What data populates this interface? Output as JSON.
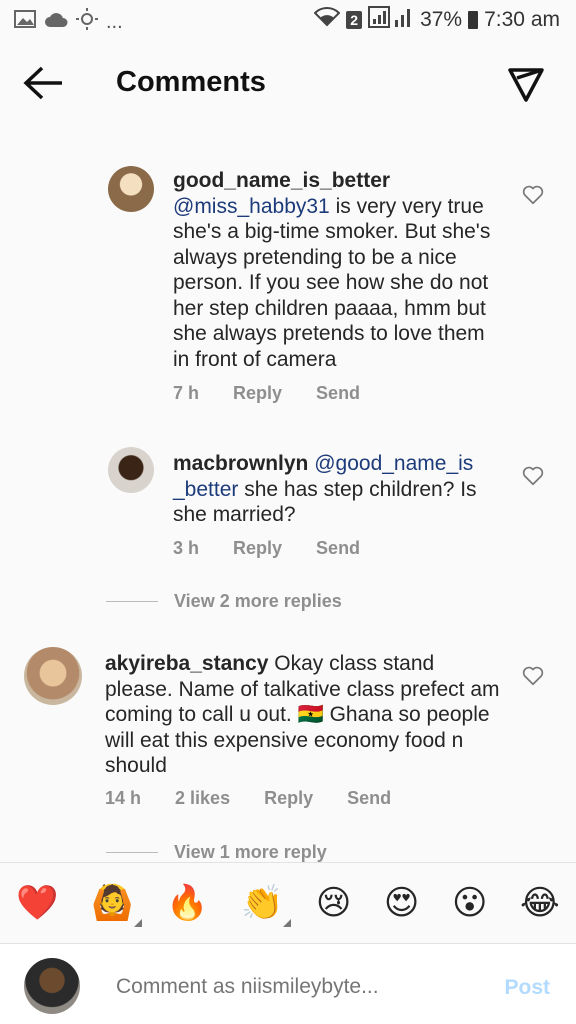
{
  "status_bar": {
    "left_icons": [
      "image-icon",
      "cloud-icon",
      "brightness-icon",
      "more-dots"
    ],
    "dots": "...",
    "sim": "2",
    "battery": "37%",
    "time": "7:30 am"
  },
  "header": {
    "title": "Comments"
  },
  "comments": [
    {
      "username": "good_name_is_better",
      "mention": "@miss_habby31",
      "text": "is very very true she's a big-time smoker. But she's always pretending to be a nice person. If you see how she do not her step children paaaa, hmm but she always pretends to love them in front of camera",
      "time": "7 h",
      "likes": "",
      "reply_label": "Reply",
      "send_label": "Send"
    },
    {
      "username": "macbrownlyn",
      "mention": "@good_name_is _better",
      "text": "she has step children? Is she married?",
      "time": "3 h",
      "likes": "",
      "reply_label": "Reply",
      "send_label": "Send"
    },
    {
      "username": "akyireba_stancy",
      "mention": "",
      "text": "Okay class stand please. Name of talkative class prefect am coming to call u out. 🇬🇭 Ghana so people will eat this expensive economy food n should",
      "time": "14 h",
      "likes": "2 likes",
      "reply_label": "Reply",
      "send_label": "Send"
    }
  ],
  "view_more_replies": "View 2 more replies",
  "view_more_reply": "View 1 more reply",
  "emoji_bar": [
    "❤️",
    "🙆",
    "🔥",
    "👏",
    "😢",
    "😍",
    "😮",
    "😂"
  ],
  "composer": {
    "placeholder": "Comment as niismileybyte...",
    "post_label": "Post"
  },
  "colors": {
    "mention": "#1d3b7a",
    "meta": "#8e8e8e",
    "post_disabled": "#b3dbff"
  }
}
